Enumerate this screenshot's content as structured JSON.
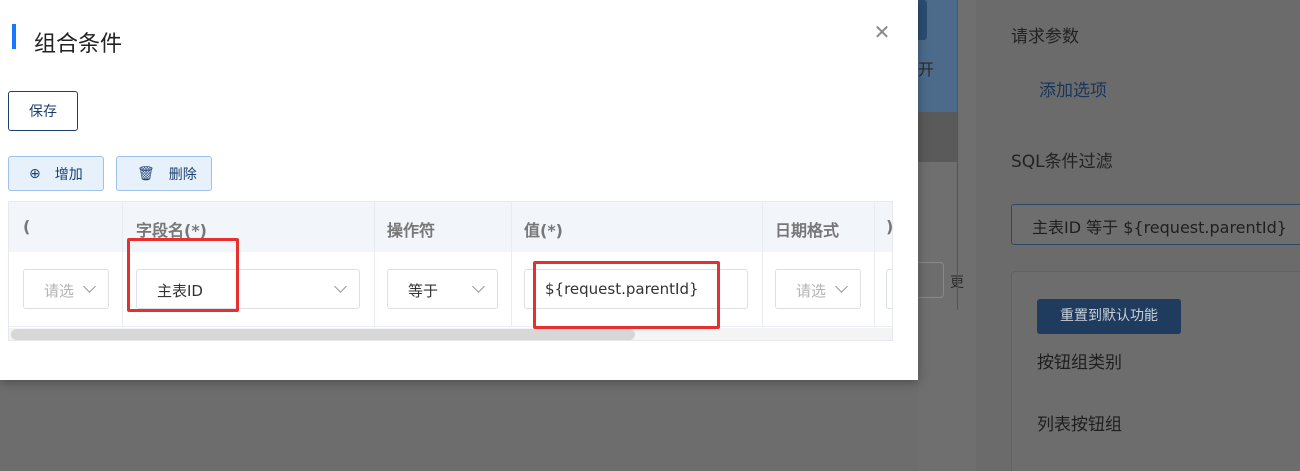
{
  "dialog": {
    "title": "组合条件",
    "save_label": "保存",
    "add_label": "增加",
    "delete_label": "删除"
  },
  "table": {
    "headers": [
      "(",
      "字段名(*)",
      "操作符",
      "值(*)",
      "日期格式",
      ")"
    ],
    "row": {
      "open_paren_placeholder": "请选",
      "field_name": "主表ID",
      "operator": "等于",
      "value": "${request.parentId}",
      "date_format_placeholder": "请选"
    }
  },
  "background": {
    "partial_text_a": "开",
    "partial_text_b": "更"
  },
  "right_panel": {
    "request_params_title": "请求参数",
    "add_option_label": "添加选项",
    "sql_filter_title": "SQL条件过滤",
    "sql_filter_value": "主表ID 等于 ${request.parentId}",
    "reset_button_label": "重置到默认功能",
    "button_group_category_label": "按钮组类别",
    "list_button_group_label": "列表按钮组"
  },
  "colors": {
    "accent": "#1677ff",
    "primary_dark": "#1d3f6e",
    "highlight_red": "#e63030",
    "overlay": "#6d6d6d"
  }
}
